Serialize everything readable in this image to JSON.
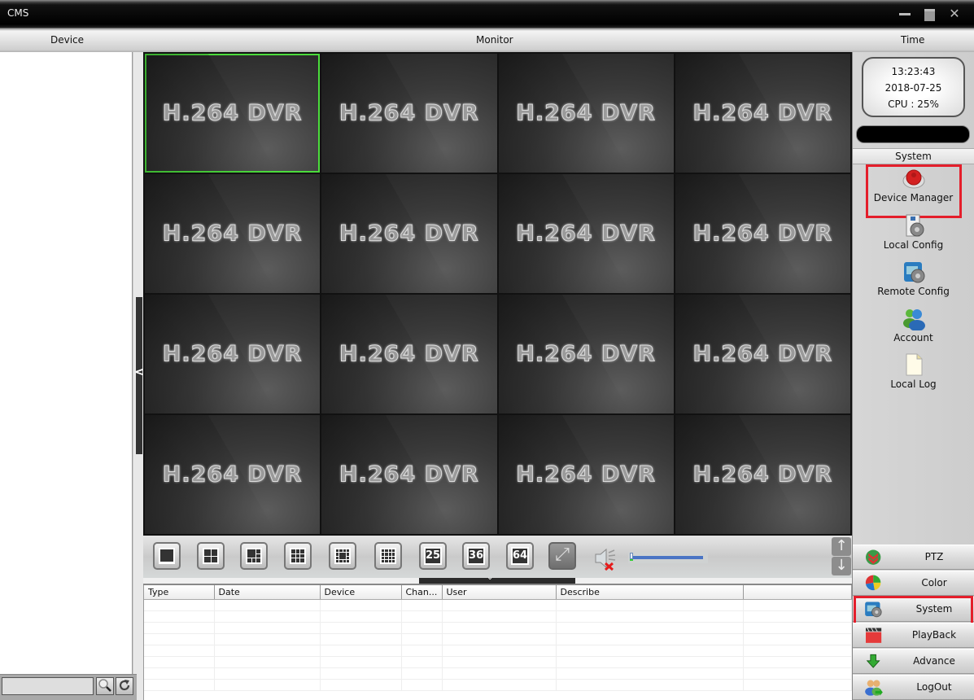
{
  "window": {
    "title": "CMS",
    "controls": [
      "minimize",
      "maximize",
      "close"
    ]
  },
  "header": {
    "device": "Device",
    "monitor": "Monitor",
    "time": "Time"
  },
  "left_panel": {
    "search_value": "",
    "search_icon": "magnifier-icon",
    "refresh_icon": "refresh-icon",
    "collapse_glyph": "<"
  },
  "monitor": {
    "grid_rows": 4,
    "grid_cols": 4,
    "selected_index": 0,
    "cells": [
      {
        "label": "H.264 DVR"
      },
      {
        "label": "H.264 DVR"
      },
      {
        "label": "H.264 DVR"
      },
      {
        "label": "H.264 DVR"
      },
      {
        "label": "H.264 DVR"
      },
      {
        "label": "H.264 DVR"
      },
      {
        "label": "H.264 DVR"
      },
      {
        "label": "H.264 DVR"
      },
      {
        "label": "H.264 DVR"
      },
      {
        "label": "H.264 DVR"
      },
      {
        "label": "H.264 DVR"
      },
      {
        "label": "H.264 DVR"
      },
      {
        "label": "H.264 DVR"
      },
      {
        "label": "H.264 DVR"
      },
      {
        "label": "H.264 DVR"
      },
      {
        "label": "H.264 DVR"
      }
    ]
  },
  "toolbar": {
    "layouts": [
      {
        "name": "layout-1",
        "kind": "grid",
        "value": "1"
      },
      {
        "name": "layout-4",
        "kind": "grid",
        "value": "4"
      },
      {
        "name": "layout-6",
        "kind": "grid",
        "value": "6"
      },
      {
        "name": "layout-9",
        "kind": "grid",
        "value": "9"
      },
      {
        "name": "layout-12",
        "kind": "grid",
        "value": "12"
      },
      {
        "name": "layout-16",
        "kind": "grid",
        "value": "16"
      },
      {
        "name": "layout-25",
        "kind": "number",
        "value": "25"
      },
      {
        "name": "layout-36",
        "kind": "number",
        "value": "36"
      },
      {
        "name": "layout-64",
        "kind": "number",
        "value": "64"
      }
    ],
    "fullscreen_icon": "fullscreen-icon",
    "mute_icon": "speaker-muted-icon",
    "volume_percent": 0,
    "scroll_up": "↑",
    "scroll_down": "↓",
    "splitter_glyph": "⌄"
  },
  "log_table": {
    "columns": [
      "Type",
      "Date",
      "Device",
      "Chan...",
      "User",
      "Describe",
      ""
    ],
    "rows": []
  },
  "right_panel": {
    "clock": {
      "time": "13:23:43",
      "date": "2018-07-25",
      "cpu": "CPU : 25%"
    },
    "section_title": "System",
    "system_items": [
      {
        "label": "Device Manager",
        "icon": "device-manager-icon",
        "highlighted": true
      },
      {
        "label": "Local Config",
        "icon": "local-config-icon",
        "highlighted": false
      },
      {
        "label": "Remote Config",
        "icon": "remote-config-icon",
        "highlighted": false
      },
      {
        "label": "Account",
        "icon": "account-icon",
        "highlighted": false
      },
      {
        "label": "Local Log",
        "icon": "local-log-icon",
        "highlighted": false
      }
    ],
    "nav_buttons": [
      {
        "label": "PTZ",
        "icon": "ptz-icon",
        "highlighted": false
      },
      {
        "label": "Color",
        "icon": "color-icon",
        "highlighted": false
      },
      {
        "label": "System",
        "icon": "system-icon",
        "highlighted": true
      },
      {
        "label": "PlayBack",
        "icon": "playback-icon",
        "highlighted": false
      },
      {
        "label": "Advance",
        "icon": "advance-icon",
        "highlighted": false
      },
      {
        "label": "LogOut",
        "icon": "logout-icon",
        "highlighted": false
      }
    ],
    "highlight_color": "#e41e2b"
  },
  "colors": {
    "selected_cell_border": "#4bdc3c",
    "volume_track": "#4a74c4"
  }
}
